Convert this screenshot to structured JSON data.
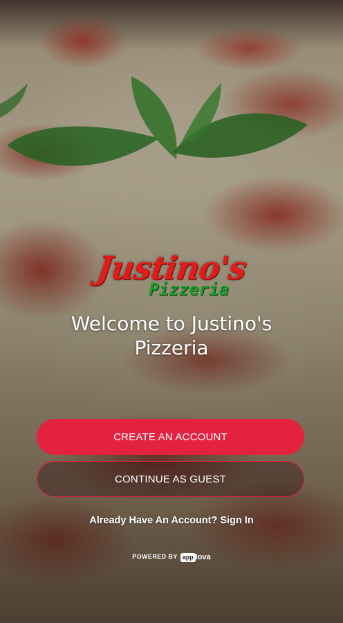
{
  "logo": {
    "main": "Justino's",
    "sub": "Pizzeria"
  },
  "welcome": {
    "line1": "Welcome to Justino's",
    "line2": "Pizzeria"
  },
  "buttons": {
    "create_label": "CREATE AN ACCOUNT",
    "guest_label": "CONTINUE AS GUEST"
  },
  "signin": {
    "label": "Already Have An Account? Sign In"
  },
  "footer": {
    "powered_by": "POWERED BY",
    "brand_box": "app",
    "brand_rest": "lova"
  },
  "colors": {
    "accent": "#e3223f",
    "logo_red": "#e31b1b",
    "logo_green": "#1f9a2f"
  },
  "icons": {
    "background": "pizza-background-image"
  }
}
